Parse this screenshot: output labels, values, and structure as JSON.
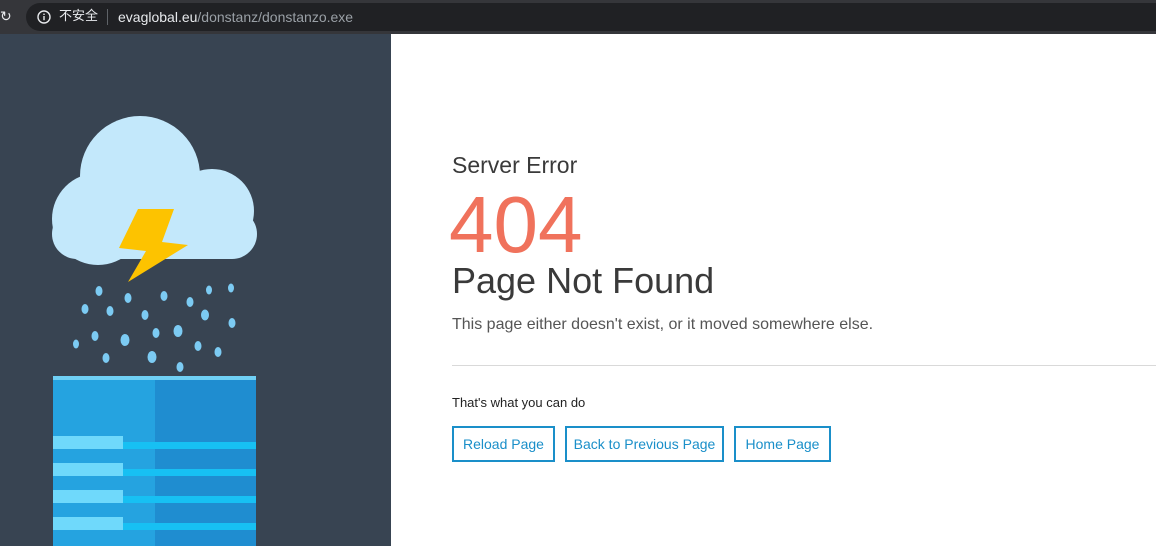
{
  "browser": {
    "reload_icon": "reload-icon",
    "security_icon": "info-icon",
    "security_label": "不安全",
    "url_host": "evaglobal.eu",
    "url_path": "/donstanz/donstanzo.exe"
  },
  "illustration": {
    "icons": [
      "cloud-icon",
      "lightning-bolt-icon",
      "raindrop-icon",
      "server-building-icon"
    ],
    "colors": {
      "panel": "#384452",
      "cloud": "#bfe6fb",
      "bolt": "#fdc300",
      "rain": "#7ccbf3",
      "building": "#25a3e0"
    }
  },
  "content": {
    "subtitle": "Server Error",
    "code": "404",
    "heading": "Page Not Found",
    "description": "This page either doesn't exist, or it moved somewhere else.",
    "actions_label": "That's what you can do",
    "buttons": [
      "Reload Page",
      "Back to Previous Page",
      "Home Page"
    ],
    "colors": {
      "code": "#f0725c",
      "button": "#1a8fc9"
    }
  }
}
